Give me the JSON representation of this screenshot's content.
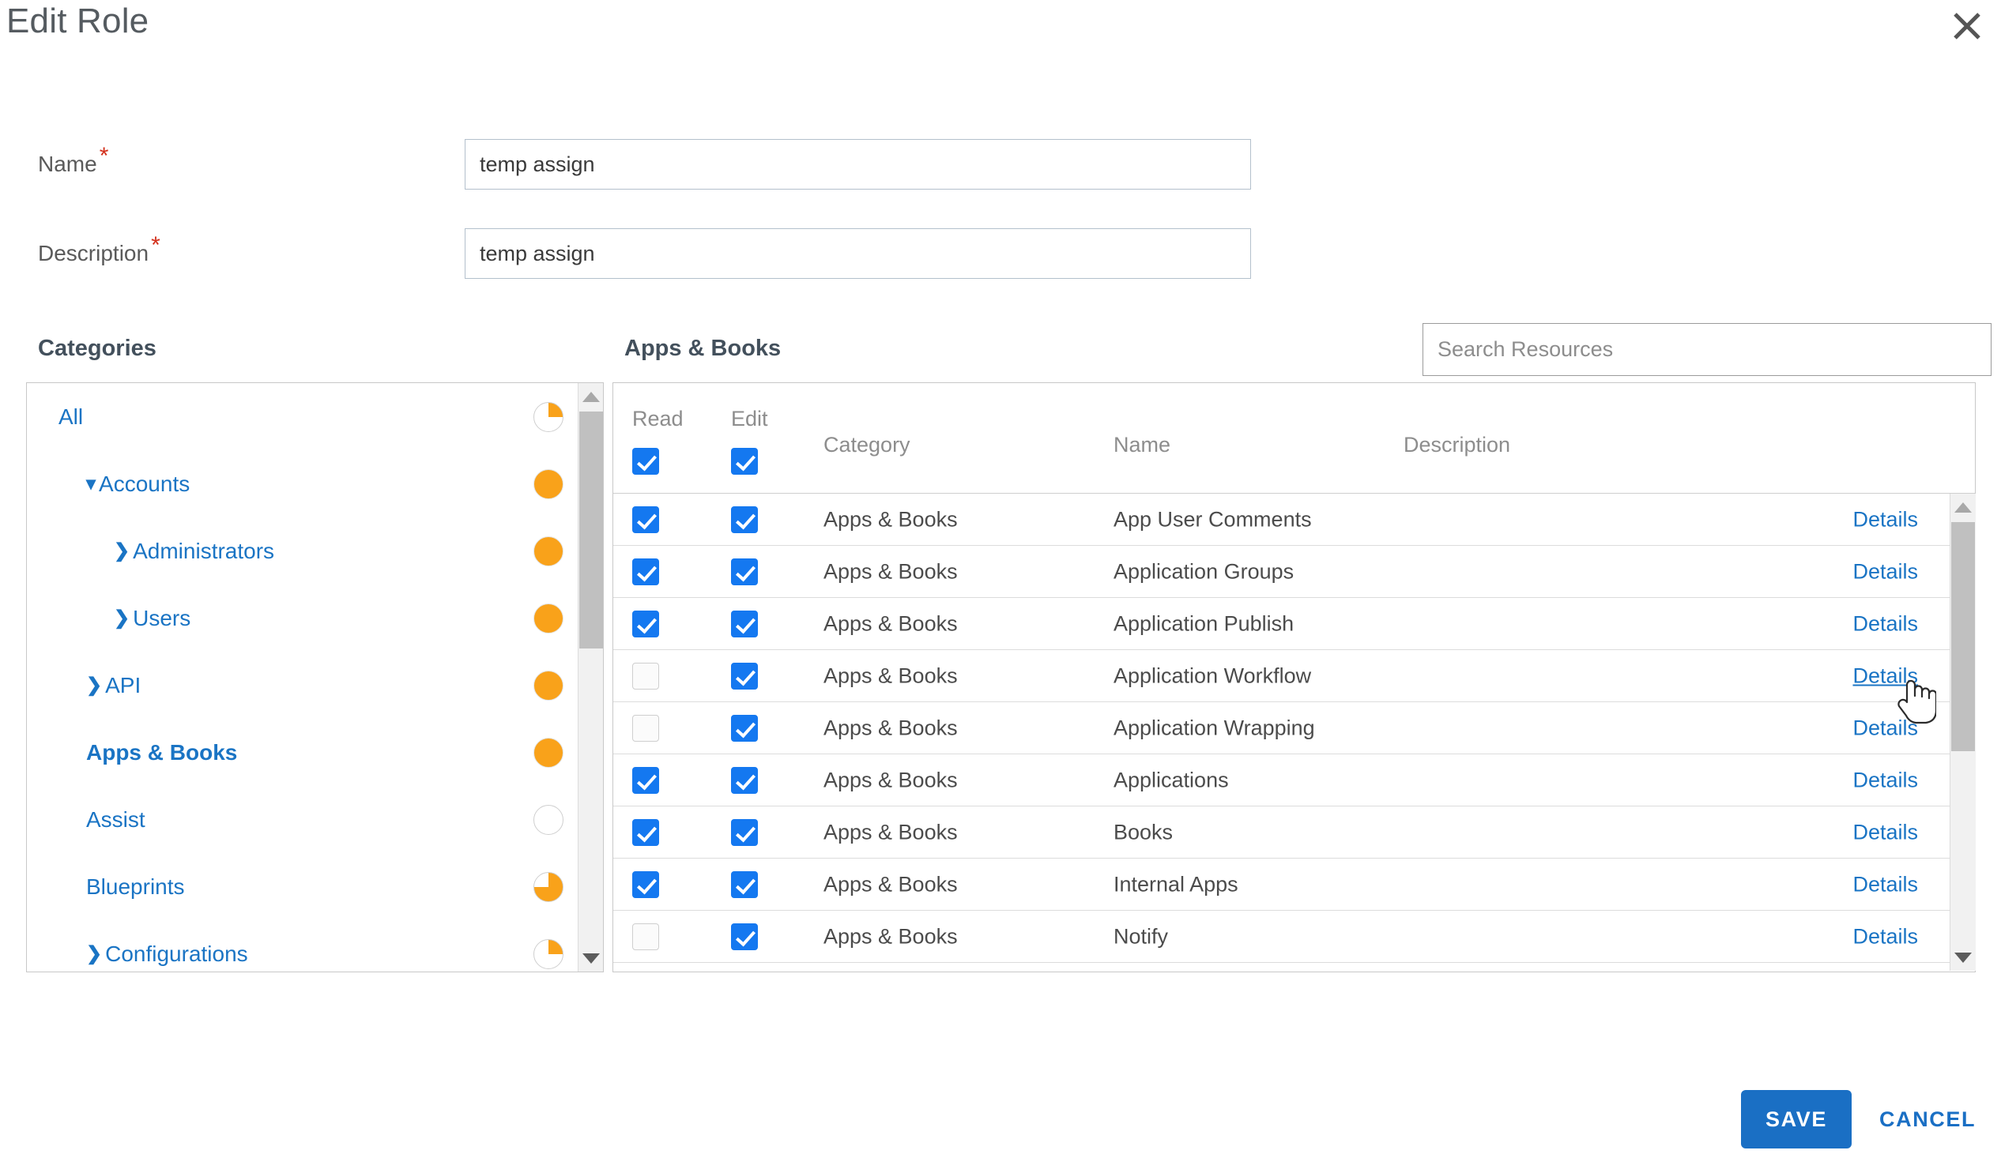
{
  "dialog": {
    "title": "Edit Role",
    "close_icon": "close-icon"
  },
  "form": {
    "name": {
      "label": "Name",
      "required_mark": "*",
      "value": "temp assign"
    },
    "description": {
      "label": "Description",
      "required_mark": "*",
      "value": "temp assign"
    }
  },
  "search": {
    "placeholder": "Search Resources",
    "value": ""
  },
  "categories": {
    "caption": "Categories",
    "items": [
      {
        "label": "All",
        "indent": 0,
        "caret": "",
        "bold": false,
        "pie": 25
      },
      {
        "label": "Accounts",
        "indent": 1,
        "caret": "▾",
        "bold": false,
        "pie": 100
      },
      {
        "label": "Administrators",
        "indent": 2,
        "caret": "❯",
        "bold": false,
        "pie": 100
      },
      {
        "label": "Users",
        "indent": 2,
        "caret": "❯",
        "bold": false,
        "pie": 100
      },
      {
        "label": "API",
        "indent": 1,
        "caret": "❯",
        "bold": false,
        "pie": 100
      },
      {
        "label": "Apps & Books",
        "indent": 1,
        "caret": "",
        "bold": true,
        "pie": 100
      },
      {
        "label": "Assist",
        "indent": 1,
        "caret": "",
        "bold": false,
        "pie": 0
      },
      {
        "label": "Blueprints",
        "indent": 1,
        "caret": "",
        "bold": false,
        "pie": 75
      },
      {
        "label": "Configurations",
        "indent": 1,
        "caret": "❯",
        "bold": false,
        "pie": 25
      }
    ]
  },
  "resources": {
    "caption": "Apps & Books",
    "columns": {
      "read": "Read",
      "edit": "Edit",
      "category": "Category",
      "name": "Name",
      "description": "Description"
    },
    "header_checkboxes": {
      "read": true,
      "edit": true
    },
    "details_label": "Details",
    "rows": [
      {
        "read": true,
        "edit": true,
        "category": "Apps & Books",
        "name": "App User Comments",
        "description": "",
        "details": "Details",
        "hover": false
      },
      {
        "read": true,
        "edit": true,
        "category": "Apps & Books",
        "name": "Application Groups",
        "description": "",
        "details": "Details",
        "hover": false
      },
      {
        "read": true,
        "edit": true,
        "category": "Apps & Books",
        "name": "Application Publish",
        "description": "",
        "details": "Details",
        "hover": false
      },
      {
        "read": false,
        "edit": true,
        "category": "Apps & Books",
        "name": "Application Workflow",
        "description": "",
        "details": "Details",
        "hover": true
      },
      {
        "read": false,
        "edit": true,
        "category": "Apps & Books",
        "name": "Application Wrapping",
        "description": "",
        "details": "Details",
        "hover": false
      },
      {
        "read": true,
        "edit": true,
        "category": "Apps & Books",
        "name": "Applications",
        "description": "",
        "details": "Details",
        "hover": false
      },
      {
        "read": true,
        "edit": true,
        "category": "Apps & Books",
        "name": "Books",
        "description": "",
        "details": "Details",
        "hover": false
      },
      {
        "read": true,
        "edit": true,
        "category": "Apps & Books",
        "name": "Internal Apps",
        "description": "",
        "details": "Details",
        "hover": false
      },
      {
        "read": false,
        "edit": true,
        "category": "Apps & Books",
        "name": "Notify",
        "description": "",
        "details": "Details",
        "hover": false
      }
    ]
  },
  "footer": {
    "save_label": "SAVE",
    "cancel_label": "CANCEL"
  },
  "colors": {
    "accent_blue": "#1a74c4",
    "save_blue": "#1a6fc4",
    "checkbox_blue": "#1478f0",
    "pie_orange": "#f9a21a",
    "required_red": "#d32f1b"
  }
}
